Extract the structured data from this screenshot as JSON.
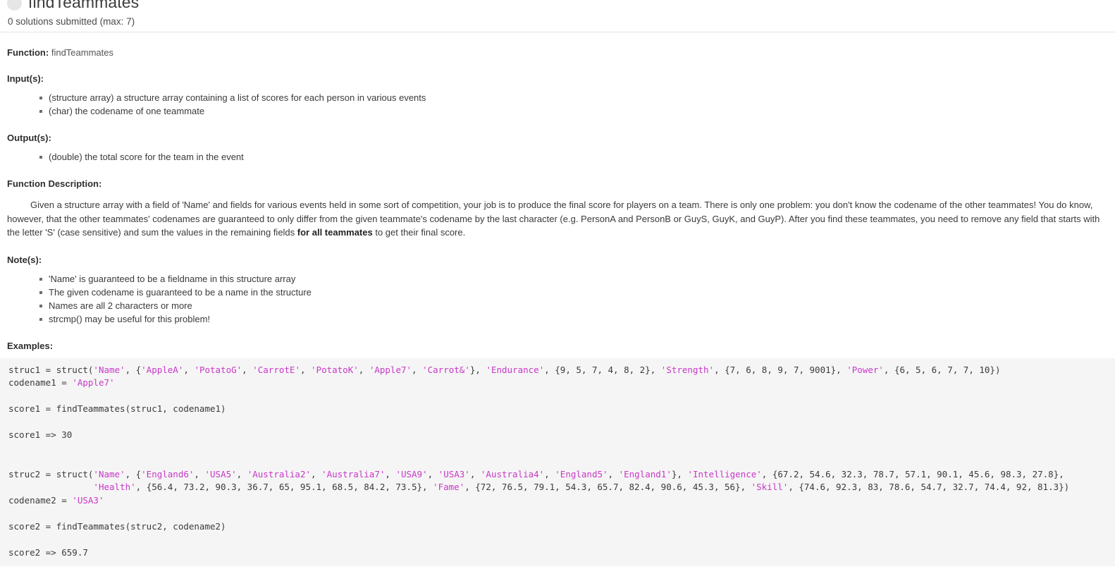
{
  "header": {
    "title": "findTeammates",
    "status_icon": "status-circle-icon",
    "submissions": "0 solutions submitted (max: 7)"
  },
  "function": {
    "label": "Function:",
    "name": "findTeammates"
  },
  "inputs": {
    "label": "Input(s):",
    "items": [
      "(structure array) a structure array containing a list of scores for each person in various events",
      "(char) the codename of one teammate"
    ]
  },
  "outputs": {
    "label": "Output(s):",
    "items": [
      "(double) the total score for the team in the event"
    ]
  },
  "description": {
    "label": "Function Description:",
    "part1": "Given a structure array with a field of 'Name' and fields for various events held in some sort of competition, your job is to produce the final score for players on a team. There is only one problem: you don't know the codename of the other teammates! You do know, however, that the other teammates' codenames are guaranteed to only differ from the given teammate's codename by the last character (e.g. PersonA and PersonB or GuyS, GuyK, and GuyP). After you find these teammates, you need to remove any field that starts with the letter 'S' (case sensitive) and sum the values in the remaining fields ",
    "bold": "for all teammates",
    "part2": " to get their final score."
  },
  "notes": {
    "label": "Note(s):",
    "items": [
      "'Name' is guaranteed to be a fieldname in this structure array",
      "The given codename is guaranteed to be a name in the structure",
      "Names are all 2 characters or more",
      "strcmp() may be useful for this problem!"
    ]
  },
  "examples": {
    "label": "Examples:",
    "code_color_string": "#c838c8",
    "code_background": "#f5f5f5",
    "lines": [
      {
        "segments": [
          {
            "t": "struc1 = struct(",
            "k": "plain"
          },
          {
            "t": "'Name'",
            "k": "str"
          },
          {
            "t": ", {",
            "k": "plain"
          },
          {
            "t": "'AppleA'",
            "k": "str"
          },
          {
            "t": ", ",
            "k": "plain"
          },
          {
            "t": "'PotatoG'",
            "k": "str"
          },
          {
            "t": ", ",
            "k": "plain"
          },
          {
            "t": "'CarrotE'",
            "k": "str"
          },
          {
            "t": ", ",
            "k": "plain"
          },
          {
            "t": "'PotatoK'",
            "k": "str"
          },
          {
            "t": ", ",
            "k": "plain"
          },
          {
            "t": "'Apple7'",
            "k": "str"
          },
          {
            "t": ", ",
            "k": "plain"
          },
          {
            "t": "'Carrot&'",
            "k": "str"
          },
          {
            "t": "}, ",
            "k": "plain"
          },
          {
            "t": "'Endurance'",
            "k": "str"
          },
          {
            "t": ", {9, 5, 7, 4, 8, 2}, ",
            "k": "plain"
          },
          {
            "t": "'Strength'",
            "k": "str"
          },
          {
            "t": ", {7, 6, 8, 9, 7, 9001}, ",
            "k": "plain"
          },
          {
            "t": "'Power'",
            "k": "str"
          },
          {
            "t": ", {6, 5, 6, 7, 7, 10})",
            "k": "plain"
          }
        ]
      },
      {
        "segments": [
          {
            "t": "codename1 = ",
            "k": "plain"
          },
          {
            "t": "'Apple7'",
            "k": "str"
          }
        ]
      },
      {
        "segments": []
      },
      {
        "segments": [
          {
            "t": "score1 = findTeammates(struc1, codename1)",
            "k": "plain"
          }
        ]
      },
      {
        "segments": []
      },
      {
        "segments": [
          {
            "t": "score1 => 30",
            "k": "plain"
          }
        ]
      },
      {
        "segments": []
      },
      {
        "segments": []
      },
      {
        "segments": [
          {
            "t": "struc2 = struct(",
            "k": "plain"
          },
          {
            "t": "'Name'",
            "k": "str"
          },
          {
            "t": ", {",
            "k": "plain"
          },
          {
            "t": "'England6'",
            "k": "str"
          },
          {
            "t": ", ",
            "k": "plain"
          },
          {
            "t": "'USA5'",
            "k": "str"
          },
          {
            "t": ", ",
            "k": "plain"
          },
          {
            "t": "'Australia2'",
            "k": "str"
          },
          {
            "t": ", ",
            "k": "plain"
          },
          {
            "t": "'Australia7'",
            "k": "str"
          },
          {
            "t": ", ",
            "k": "plain"
          },
          {
            "t": "'USA9'",
            "k": "str"
          },
          {
            "t": ", ",
            "k": "plain"
          },
          {
            "t": "'USA3'",
            "k": "str"
          },
          {
            "t": ", ",
            "k": "plain"
          },
          {
            "t": "'Australia4'",
            "k": "str"
          },
          {
            "t": ", ",
            "k": "plain"
          },
          {
            "t": "'England5'",
            "k": "str"
          },
          {
            "t": ", ",
            "k": "plain"
          },
          {
            "t": "'England1'",
            "k": "str"
          },
          {
            "t": "}, ",
            "k": "plain"
          },
          {
            "t": "'Intelligence'",
            "k": "str"
          },
          {
            "t": ", {67.2, 54.6, 32.3, 78.7, 57.1, 90.1, 45.6, 98.3, 27.8},",
            "k": "plain"
          }
        ]
      },
      {
        "segments": [
          {
            "t": "                ",
            "k": "plain"
          },
          {
            "t": "'Health'",
            "k": "str"
          },
          {
            "t": ", {56.4, 73.2, 90.3, 36.7, 65, 95.1, 68.5, 84.2, 73.5}, ",
            "k": "plain"
          },
          {
            "t": "'Fame'",
            "k": "str"
          },
          {
            "t": ", {72, 76.5, 79.1, 54.3, 65.7, 82.4, 90.6, 45.3, 56}, ",
            "k": "plain"
          },
          {
            "t": "'Skill'",
            "k": "str"
          },
          {
            "t": ", {74.6, 92.3, 83, 78.6, 54.7, 32.7, 74.4, 92, 81.3})",
            "k": "plain"
          }
        ]
      },
      {
        "segments": [
          {
            "t": "codename2 = ",
            "k": "plain"
          },
          {
            "t": "'USA3'",
            "k": "str"
          }
        ]
      },
      {
        "segments": []
      },
      {
        "segments": [
          {
            "t": "score2 = findTeammates(struc2, codename2)",
            "k": "plain"
          }
        ]
      },
      {
        "segments": []
      },
      {
        "segments": [
          {
            "t": "score2 => 659.7",
            "k": "plain"
          }
        ]
      }
    ]
  }
}
